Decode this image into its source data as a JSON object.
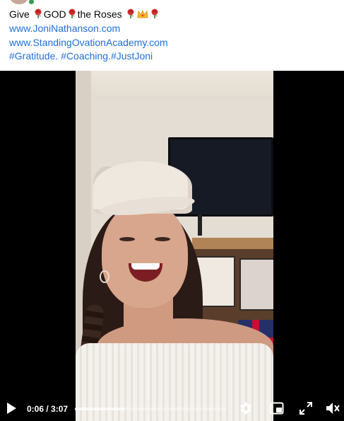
{
  "post": {
    "text_parts": {
      "give": "Give",
      "god": "GOD",
      "the_roses": "the Roses"
    },
    "emoji": [
      "rose-icon",
      "rose-icon",
      "rose-icon",
      "crown-icon",
      "rose-icon"
    ],
    "links": {
      "site1": "www.JoniNathanson.com",
      "site2": "www.StandingOvationAcademy.com"
    },
    "hashtags": "#Gratitude. #Coaching.#JustJoni"
  },
  "player": {
    "time_display": "0:06 / 3:07",
    "progress_fraction": 0.032,
    "buffered_fraction": 0.33,
    "controls": [
      "play-icon",
      "settings-gear-icon",
      "picture-in-picture-icon",
      "fullscreen-icon",
      "volume-muted-icon"
    ]
  },
  "colors": {
    "link": "#216fdb",
    "text": "#050505",
    "video_bg": "#000000"
  }
}
